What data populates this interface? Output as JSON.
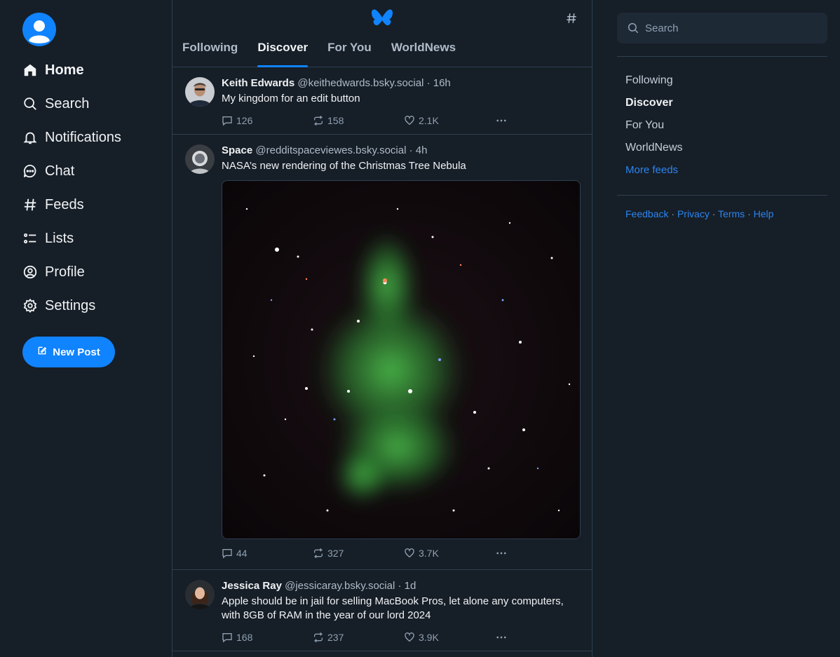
{
  "nav": {
    "items": [
      {
        "label": "Home",
        "icon": "home-icon"
      },
      {
        "label": "Search",
        "icon": "search-icon"
      },
      {
        "label": "Notifications",
        "icon": "bell-icon"
      },
      {
        "label": "Chat",
        "icon": "chat-icon"
      },
      {
        "label": "Feeds",
        "icon": "hash-icon"
      },
      {
        "label": "Lists",
        "icon": "list-icon"
      },
      {
        "label": "Profile",
        "icon": "profile-icon"
      },
      {
        "label": "Settings",
        "icon": "gear-icon"
      }
    ],
    "new_post_label": "New Post"
  },
  "header": {
    "tabs": [
      "Following",
      "Discover",
      "For You",
      "WorldNews"
    ],
    "active_tab": "Discover"
  },
  "posts": [
    {
      "name": "Keith Edwards",
      "handle": "@keithedwards.bsky.social",
      "time": "16h",
      "text": "My kingdom for an edit button",
      "replies": "126",
      "reposts": "158",
      "likes": "2.1K"
    },
    {
      "name": "Space",
      "handle": "@redditspaceviewes.bsky.social",
      "time": "4h",
      "text": "NASA’s new rendering of the Christmas Tree Nebula",
      "replies": "44",
      "reposts": "327",
      "likes": "3.7K"
    },
    {
      "name": "Jessica Ray",
      "handle": "@jessicaray.bsky.social",
      "time": "1d",
      "text": "Apple should be in jail for selling MacBook Pros, let alone any computers, with 8GB of RAM in the year of our lord 2024",
      "replies": "168",
      "reposts": "237",
      "likes": "3.9K"
    }
  ],
  "sidebar": {
    "search_placeholder": "Search",
    "feeds": [
      "Following",
      "Discover",
      "For You",
      "WorldNews"
    ],
    "more_feeds": "More feeds",
    "footer": [
      "Feedback",
      "Privacy",
      "Terms",
      "Help"
    ]
  },
  "colors": {
    "background": "#161e27",
    "accent": "#1083fe",
    "link": "#2b85f0",
    "border": "#2e4052"
  }
}
